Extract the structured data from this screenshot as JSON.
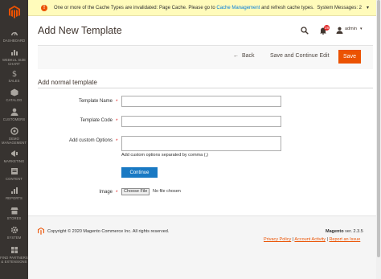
{
  "sidebar": {
    "items": [
      {
        "icon": "dashboard-icon",
        "label": "DASHBOARD"
      },
      {
        "icon": "sales-chart-icon",
        "label": "WEBKUL SIZE CHART"
      },
      {
        "icon": "dollar-icon",
        "label": "SALES"
      },
      {
        "icon": "catalog-icon",
        "label": "CATALOG"
      },
      {
        "icon": "customers-icon",
        "label": "CUSTOMERS"
      },
      {
        "icon": "demo-icon",
        "label": "DEMO MANAGEMENT"
      },
      {
        "icon": "marketing-icon",
        "label": "MARKETING"
      },
      {
        "icon": "content-icon",
        "label": "CONTENT"
      },
      {
        "icon": "reports-icon",
        "label": "REPORTS"
      },
      {
        "icon": "stores-icon",
        "label": "STORES"
      },
      {
        "icon": "system-icon",
        "label": "SYSTEM"
      },
      {
        "icon": "partners-icon",
        "label": "FIND PARTNERS & EXTENSIONS"
      }
    ]
  },
  "notice": {
    "text_before": "One or more of the Cache Types are invalidated: Page Cache. Please go to",
    "link": "Cache Management",
    "text_after": "and refresh cache types.",
    "system_messages": "System Messages: 2"
  },
  "header": {
    "title": "Add New Template",
    "notifications_count": "28",
    "user": "admin"
  },
  "actions": {
    "back": "Back",
    "save_continue": "Save and Continue Edit",
    "save": "Save"
  },
  "form": {
    "section_title": "Add normal template",
    "template_name_label": "Template Name",
    "template_code_label": "Template Code",
    "custom_options_label": "Add custom Options",
    "custom_options_hint": "Add custom options separated by comma (,)",
    "continue_button": "Continue",
    "image_label": "Image",
    "choose_file": "Choose File",
    "no_file": "No file chosen",
    "template_name_value": "",
    "template_code_value": "",
    "custom_options_value": ""
  },
  "footer": {
    "copyright": "Copyright © 2020 Magento Commerce Inc. All rights reserved.",
    "brand": "Magento",
    "version": "ver. 2.3.5",
    "links": [
      "Privacy Policy",
      "Account Activity",
      "Report an Issue"
    ]
  },
  "colors": {
    "accent": "#eb5202",
    "primary_button": "#1979c3",
    "sidebar": "#373330",
    "notice_bg": "#fffbbb"
  }
}
